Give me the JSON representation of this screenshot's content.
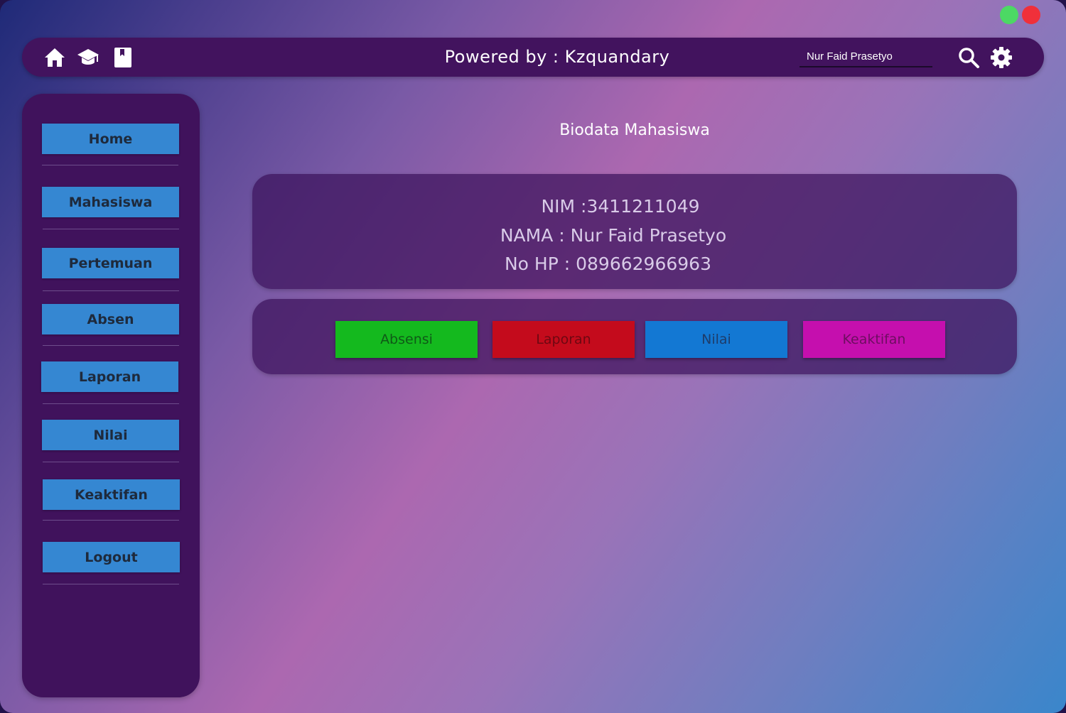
{
  "window": {
    "controls": [
      "maximize",
      "close"
    ],
    "colors": {
      "maximize": "#4cd964",
      "close": "#f0303a"
    }
  },
  "topbar": {
    "icons": [
      "home-icon",
      "graduation-cap-icon",
      "book-icon",
      "search-icon",
      "gear-icon"
    ],
    "powered_by": "Powered by : Kzquandary",
    "search_value": "Nur Faid Prasetyo"
  },
  "sidebar": {
    "items": [
      {
        "label": "Home"
      },
      {
        "label": "Mahasiswa"
      },
      {
        "label": "Pertemuan"
      },
      {
        "label": "Absen"
      },
      {
        "label": "Laporan"
      },
      {
        "label": "Nilai"
      },
      {
        "label": "Keaktifan"
      },
      {
        "label": "Logout"
      }
    ]
  },
  "main": {
    "title": "Biodata Mahasiswa",
    "biodata": {
      "nim": "NIM :3411211049",
      "nama": "NAMA : Nur Faid Prasetyo",
      "no_hp": "No HP : 089662966963"
    },
    "actions": [
      {
        "label": "Absensi",
        "color": "#14b91e"
      },
      {
        "label": "Laporan",
        "color": "#c40b1c"
      },
      {
        "label": "Nilai",
        "color": "#1378d3"
      },
      {
        "label": "Keaktifan",
        "color": "#c50fae"
      }
    ]
  }
}
